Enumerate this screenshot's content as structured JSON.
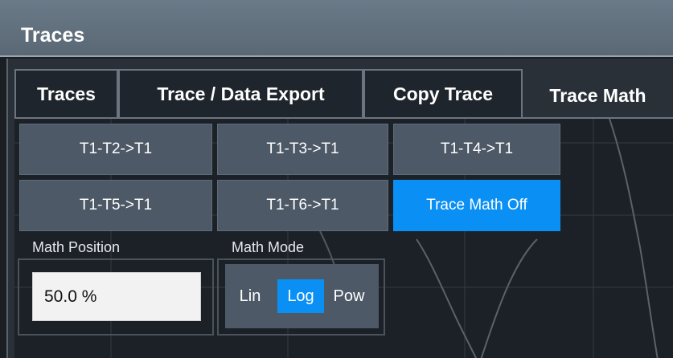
{
  "window": {
    "title": "Traces"
  },
  "tabs": [
    {
      "label": "Traces"
    },
    {
      "label": "Trace / Data Export"
    },
    {
      "label": "Copy Trace"
    },
    {
      "label": "Trace Math",
      "active": true
    }
  ],
  "math_buttons": [
    {
      "label": "T1-T2->T1"
    },
    {
      "label": "T1-T3->T1"
    },
    {
      "label": "T1-T4->T1"
    },
    {
      "label": "T1-T5->T1"
    },
    {
      "label": "T1-T6->T1"
    },
    {
      "label": "Trace Math Off",
      "active": true
    }
  ],
  "math_position": {
    "label": "Math Position",
    "value": "50.0 %"
  },
  "math_mode": {
    "label": "Math Mode",
    "options": [
      {
        "label": "Lin"
      },
      {
        "label": "Log",
        "active": true
      },
      {
        "label": "Pow"
      }
    ]
  },
  "colors": {
    "accent": "#0a8ff5",
    "button": "#4d5967"
  }
}
